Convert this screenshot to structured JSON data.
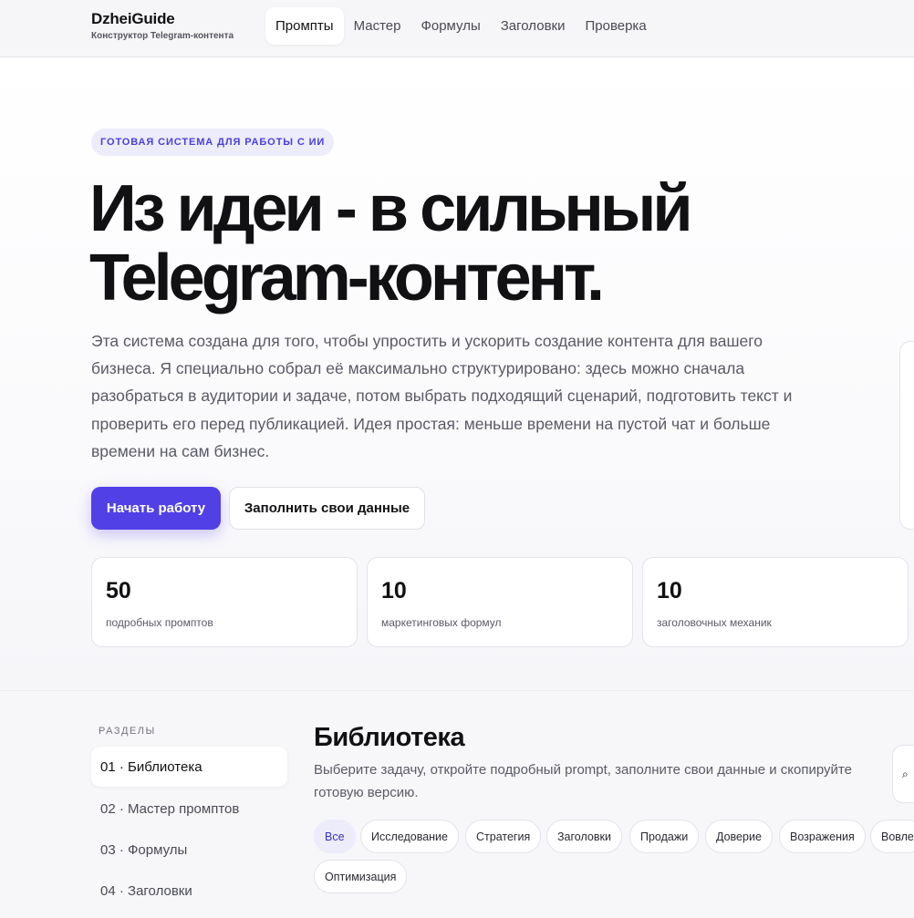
{
  "brand": {
    "title": "DzheiGuide",
    "subtitle": "Конструктор Telegram-контента"
  },
  "nav": [
    {
      "label": "Промпты",
      "active": true
    },
    {
      "label": "Мастер"
    },
    {
      "label": "Формулы"
    },
    {
      "label": "Заголовки"
    },
    {
      "label": "Проверка"
    }
  ],
  "hero": {
    "eyebrow": "ГОТОВАЯ СИСТЕМА ДЛЯ РАБОТЫ С ИИ",
    "headline_line1": "Из идеи - в сильный",
    "headline_line2": "Telegram-контент.",
    "lead": "Эта система создана для того, чтобы упростить и ускорить создание контента для вашего бизнеса. Я специально собрал её максимально структурировано: здесь можно сначала разобраться в аудитории и задаче, потом выбрать подходящий сценарий, подготовить текст и проверить его перед публикацией. Идея простая: меньше времени на пустой чат и больше времени на сам бизнес.",
    "primary_button": "Начать работу",
    "secondary_button": "Заполнить свои данные"
  },
  "stats": [
    {
      "value": "50",
      "label": "подробных промптов"
    },
    {
      "value": "10",
      "label": "маркетинговых формул"
    },
    {
      "value": "10",
      "label": "заголовочных механик"
    }
  ],
  "sidebar": {
    "heading": "РАЗДЕЛЫ",
    "items": [
      {
        "label": "01 · Библиотека",
        "active": true
      },
      {
        "label": "02 · Мастер промптов"
      },
      {
        "label": "03 · Формулы"
      },
      {
        "label": "04 · Заголовки"
      }
    ]
  },
  "library": {
    "title": "Библиотека",
    "description": "Выберите задачу, откройте подробный prompt, заполните свои данные и скопируйте готовую версию.",
    "search_icon": "search-icon",
    "filters": [
      "Все",
      "Исследование",
      "Стратегия",
      "Заголовки",
      "Продажи",
      "Доверие",
      "Возражения",
      "Вовле",
      "Оптимизация"
    ]
  },
  "colors": {
    "accent": "#5140e6",
    "accent_soft": "#ececfb",
    "text": "#111114",
    "muted": "#5a5a66"
  }
}
